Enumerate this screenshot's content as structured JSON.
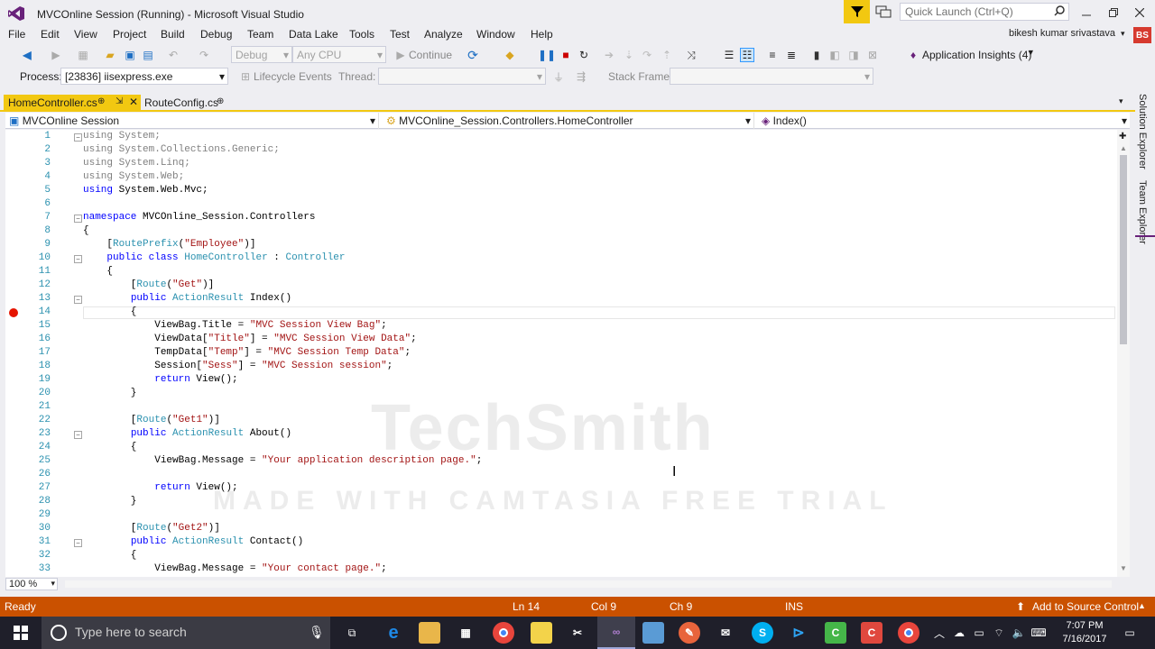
{
  "window": {
    "title": "MVCOnline Session (Running) - Microsoft Visual Studio",
    "quick_launch_placeholder": "Quick Launch (Ctrl+Q)"
  },
  "menu": [
    "File",
    "Edit",
    "View",
    "Project",
    "Build",
    "Debug",
    "Team",
    "Data Lake",
    "Tools",
    "Test",
    "Analyze",
    "Window",
    "Help"
  ],
  "user": {
    "name": "bikesh kumar srivastava",
    "initials": "BS"
  },
  "toolbar": {
    "config": "Debug",
    "platform": "Any CPU",
    "continue_label": "Continue",
    "app_insights": "Application Insights (4)"
  },
  "debug_toolbar": {
    "process_label": "Process:",
    "process_value": "[23836] iisexpress.exe",
    "lifecycle_label": "Lifecycle Events",
    "thread_label": "Thread:",
    "stack_frame_label": "Stack Frame:"
  },
  "tabs": [
    {
      "label": "HomeController.cs",
      "active": true
    },
    {
      "label": "RouteConfig.cs",
      "active": false
    }
  ],
  "nav": {
    "project": "MVCOnline Session",
    "class": "MVCOnline_Session.Controllers.HomeController",
    "member": "Index()"
  },
  "code_lines": [
    {
      "n": "1",
      "t": "using System;"
    },
    {
      "n": "2",
      "t": "using System.Collections.Generic;"
    },
    {
      "n": "3",
      "t": "using System.Linq;"
    },
    {
      "n": "4",
      "t": "using System.Web;"
    },
    {
      "n": "5",
      "t": "using System.Web.Mvc;"
    },
    {
      "n": "6",
      "t": ""
    },
    {
      "n": "7",
      "t": "namespace MVCOnline_Session.Controllers"
    },
    {
      "n": "8",
      "t": "{"
    },
    {
      "n": "9",
      "t": "    [RoutePrefix(\"Employee\")]"
    },
    {
      "n": "10",
      "t": "    public class HomeController : Controller"
    },
    {
      "n": "11",
      "t": "    {"
    },
    {
      "n": "12",
      "t": "        [Route(\"Get\")]"
    },
    {
      "n": "13",
      "t": "        public ActionResult Index()"
    },
    {
      "n": "14",
      "t": "        {"
    },
    {
      "n": "15",
      "t": "            ViewBag.Title = \"MVC Session View Bag\";"
    },
    {
      "n": "16",
      "t": "            ViewData[\"Title\"] = \"MVC Session View Data\";"
    },
    {
      "n": "17",
      "t": "            TempData[\"Temp\"] = \"MVC Session Temp Data\";"
    },
    {
      "n": "18",
      "t": "            Session[\"Sess\"] = \"MVC Session session\";"
    },
    {
      "n": "19",
      "t": "            return View();"
    },
    {
      "n": "20",
      "t": "        }"
    },
    {
      "n": "21",
      "t": ""
    },
    {
      "n": "22",
      "t": "        [Route(\"Get1\")]"
    },
    {
      "n": "23",
      "t": "        public ActionResult About()"
    },
    {
      "n": "24",
      "t": "        {"
    },
    {
      "n": "25",
      "t": "            ViewBag.Message = \"Your application description page.\";"
    },
    {
      "n": "26",
      "t": ""
    },
    {
      "n": "27",
      "t": "            return View();"
    },
    {
      "n": "28",
      "t": "        }"
    },
    {
      "n": "29",
      "t": ""
    },
    {
      "n": "30",
      "t": "        [Route(\"Get2\")]"
    },
    {
      "n": "31",
      "t": "        public ActionResult Contact()"
    },
    {
      "n": "32",
      "t": "        {"
    },
    {
      "n": "33",
      "t": "            ViewBag.Message = \"Your contact page.\";"
    }
  ],
  "watermark": {
    "line1": "TechSmith",
    "line2": "MADE WITH CAMTASIA FREE TRIAL"
  },
  "side_tabs": [
    "Solution Explorer",
    "Team Explorer"
  ],
  "zoom": "100 %",
  "status": {
    "ready": "Ready",
    "line": "Ln 14",
    "col": "Col 9",
    "ch": "Ch 9",
    "mode": "INS",
    "source_control": "Add to Source Control"
  },
  "taskbar": {
    "search_placeholder": "Type here to search",
    "time": "7:07 PM",
    "date": "7/16/2017"
  },
  "colors": {
    "accent": "#f2c811",
    "status": "#ca5100",
    "taskbar": "#1f1f2a"
  }
}
